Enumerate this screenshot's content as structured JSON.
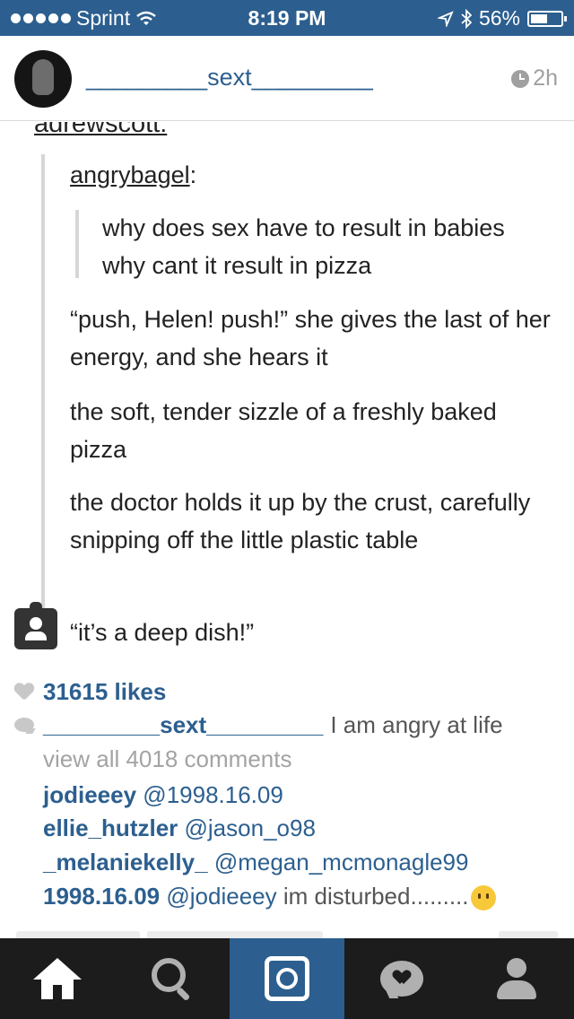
{
  "status_bar": {
    "carrier": "Sprint",
    "time": "8:19 PM",
    "battery": "56%",
    "battery_level": 0.56
  },
  "post": {
    "username": "_________sext_________",
    "time_ago": "2h",
    "image": {
      "cut_off_name": "adrewscott:",
      "quote_author": "angrybagel",
      "quote_text": "why does sex have to result in babies why cant it result in pizza",
      "paragraphs": [
        "“push, Helen! push!” she gives the last of her energy, and she hears it",
        "the soft, tender sizzle of a freshly baked pizza",
        "the doctor holds it up by the crust, carefully snipping off the little plastic table",
        "“it’s a deep dish!”"
      ]
    },
    "likes": "31615 likes",
    "caption": {
      "user": "_________sext_________",
      "text": "I am angry at life"
    },
    "view_all": "view all 4018 comments",
    "comments": [
      {
        "user": "jodieeey",
        "tag": "@1998.16.09",
        "text": ""
      },
      {
        "user": "ellie_hutzler",
        "tag": "@jason_o98",
        "text": ""
      },
      {
        "user": "_melaniekelly_",
        "tag": "@megan_mcmonagle99",
        "text": ""
      },
      {
        "user": "1998.16.09",
        "tag": "@jodieeey",
        "text": "im disturbed........."
      }
    ]
  },
  "tabs": [
    "home",
    "search",
    "camera",
    "activity",
    "profile"
  ],
  "colors": {
    "accent": "#2c5f8f",
    "tabbar": "#1c1c1c",
    "muted": "#a3a3a3"
  }
}
